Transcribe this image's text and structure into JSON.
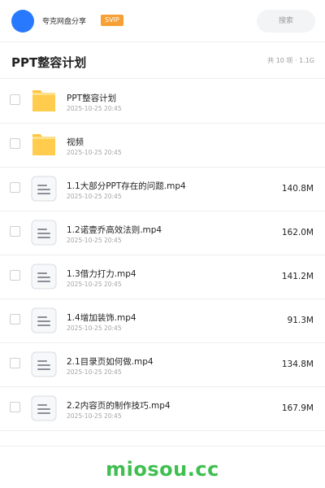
{
  "header": {
    "brand": "夸克网盘分享",
    "badge": "SVIP",
    "search_placeholder": "搜索"
  },
  "title_bar": {
    "title": "PPT整容计划",
    "summary": "共 10 项 · 1.1G"
  },
  "items": [
    {
      "type": "folder",
      "icon": "folder-icon",
      "name": "PPT整容计划",
      "time": "2025-10-25 20:45",
      "size": ""
    },
    {
      "type": "folder",
      "icon": "folder-icon",
      "name": "视频",
      "time": "2025-10-25 20:45",
      "size": ""
    },
    {
      "type": "file",
      "icon": "file-icon",
      "name": "1.1大部分PPT存在的问题.mp4",
      "time": "2025-10-25 20:45",
      "size": "140.8M"
    },
    {
      "type": "file",
      "icon": "file-icon",
      "name": "1.2诺壹乔高效法则.mp4",
      "time": "2025-10-25 20:45",
      "size": "162.0M"
    },
    {
      "type": "file",
      "icon": "file-icon",
      "name": "1.3借力打力.mp4",
      "time": "2025-10-25 20:45",
      "size": "141.2M"
    },
    {
      "type": "file",
      "icon": "file-icon",
      "name": "1.4增加装饰.mp4",
      "time": "2025-10-25 20:45",
      "size": "91.3M"
    },
    {
      "type": "file",
      "icon": "file-icon",
      "name": "2.1目录页如何做.mp4",
      "time": "2025-10-25 20:45",
      "size": "134.8M"
    },
    {
      "type": "file",
      "icon": "file-icon",
      "name": "2.2内容页的制作技巧.mp4",
      "time": "2025-10-25 20:45",
      "size": "167.9M"
    }
  ],
  "footer": {
    "watermark": "miosou.cc"
  },
  "colors": {
    "accent": "#2979ff",
    "badge": "#f7a135",
    "folder": "#ffc53d",
    "watermark": "#3fbf4f"
  }
}
